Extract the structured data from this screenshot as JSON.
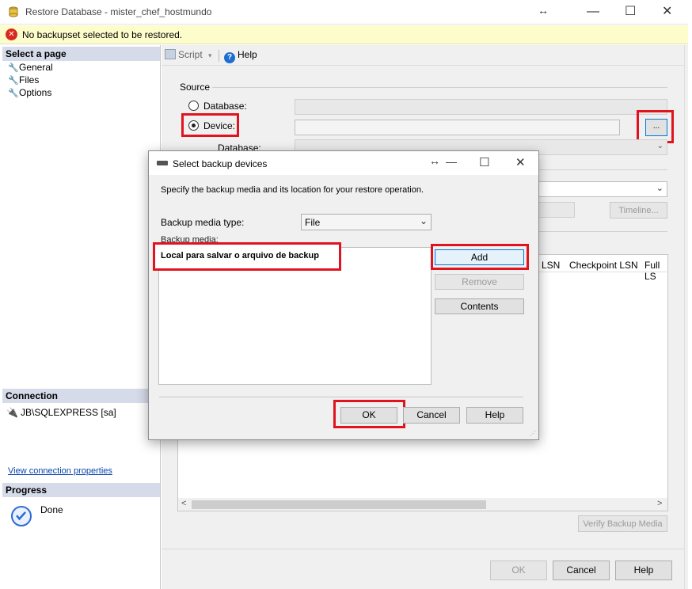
{
  "window": {
    "title": "Restore Database - mister_chef_hostmundo",
    "move_glyph": "↔",
    "minimize_glyph": "—",
    "maximize_glyph": "☐",
    "close_glyph": "✕"
  },
  "error_bar": {
    "icon": "error-icon",
    "message": "No backupset selected to be restored."
  },
  "left": {
    "select_page_header": "Select a page",
    "pages": [
      {
        "label": "General",
        "icon": "wrench-icon"
      },
      {
        "label": "Files",
        "icon": "wrench-icon"
      },
      {
        "label": "Options",
        "icon": "wrench-icon"
      }
    ],
    "connection_header": "Connection",
    "connection_value": "JB\\SQLEXPRESS [sa]",
    "view_connection_link": "View connection properties",
    "progress_header": "Progress",
    "progress_status": "Done"
  },
  "toolbar": {
    "script_label": "Script",
    "help_label": "Help"
  },
  "source": {
    "section_label": "Source",
    "database_radio_label": "Database:",
    "device_radio_label": "Device:",
    "database_sub_label": "Database:",
    "browse_button_label": "...",
    "selected_radio": "device"
  },
  "destination": {
    "timeline_button_label": "Timeline..."
  },
  "grid": {
    "col_lsn": "LSN",
    "col_checkpoint_lsn": "Checkpoint LSN",
    "col_full_lsn": "Full LS",
    "scroll_left": "<",
    "scroll_right": ">"
  },
  "verify_button_label": "Verify Backup Media",
  "footer": {
    "ok_label": "OK",
    "cancel_label": "Cancel",
    "help_label": "Help"
  },
  "modal": {
    "title": "Select backup devices",
    "description": "Specify the backup media and its location for your restore operation.",
    "media_type_label": "Backup media type:",
    "media_type_value": "File",
    "media_label": "Backup media:",
    "media_list_annotation": "Local para salvar o arquivo de backup",
    "add_label": "Add",
    "remove_label": "Remove",
    "contents_label": "Contents",
    "ok_label": "OK",
    "cancel_label": "Cancel",
    "help_label": "Help",
    "move_glyph": "↔",
    "minimize_glyph": "—",
    "maximize_glyph": "☐",
    "close_glyph": "✕"
  },
  "colors": {
    "highlight_red": "#e0141e",
    "error_bar_bg": "#fdfccb",
    "section_header_bg": "#d6dbe9",
    "link_blue": "#0645ad",
    "add_button_border": "#0078d7"
  }
}
